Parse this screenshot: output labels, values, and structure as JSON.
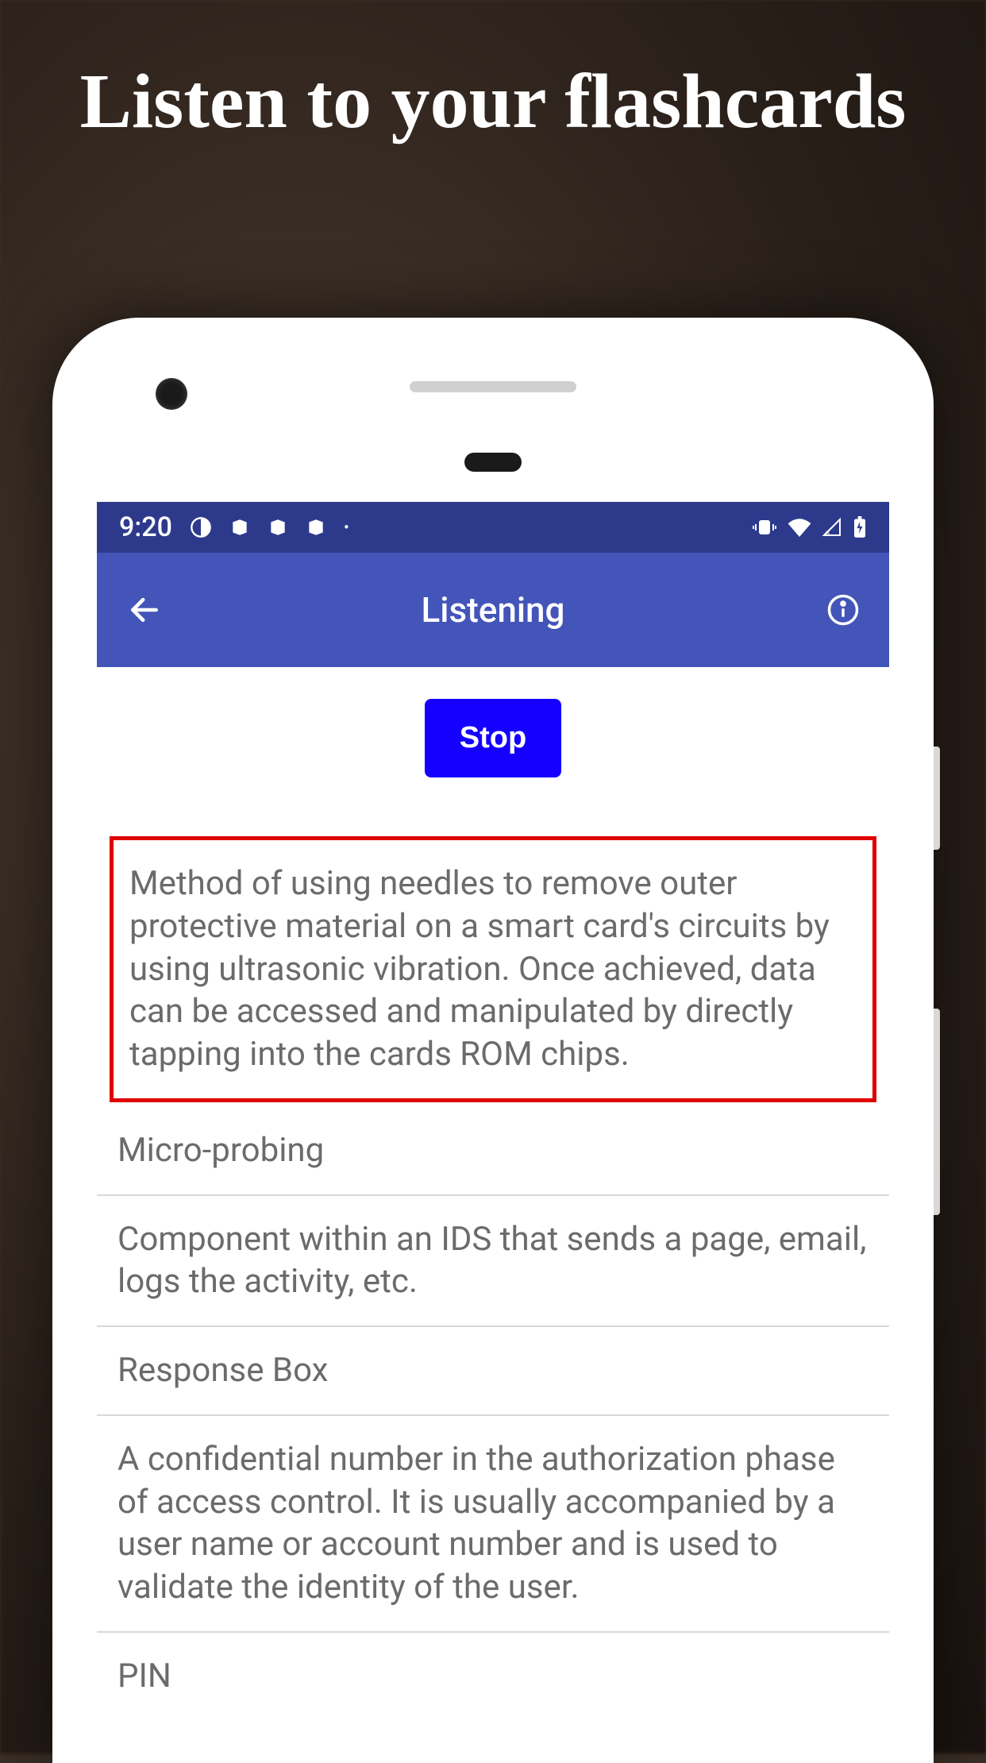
{
  "headline": "Listen to your flashcards",
  "status_bar": {
    "time": "9:20"
  },
  "app_bar": {
    "title": "Listening"
  },
  "controls": {
    "stop_label": "Stop"
  },
  "cards": {
    "highlighted": "Method of using needles to remove outer protective material on a smart card's circuits by using ultrasonic vibration. Once achieved, data can be accessed and manipulated by directly tapping into the cards ROM chips.",
    "items": [
      "Micro-probing",
      "Component within an IDS that sends a page, email, logs the activity, etc.",
      "Response Box",
      "A confidential number in the authorization phase of access control. It is usually accompanied by a user name or account number and is used to validate the identity of the user.",
      "PIN"
    ]
  }
}
